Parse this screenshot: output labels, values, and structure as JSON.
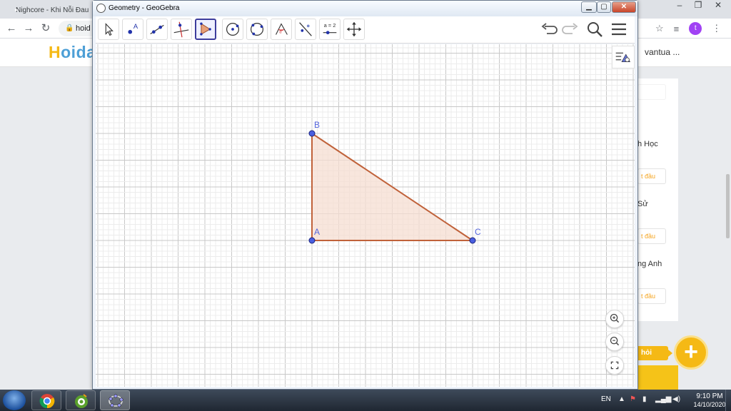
{
  "browser": {
    "tabs": [
      {
        "title": "Nighcore - Khi Nỗi Đau",
        "favicon": "youtube-icon"
      }
    ],
    "address": {
      "text": "hoid"
    },
    "profile_initial": "t",
    "controls": {
      "minimize": "–",
      "maximize": "❐",
      "close": "✕"
    }
  },
  "site": {
    "logo_prefix": "H",
    "logo_rest": "oidap",
    "user_name": "vantua ...",
    "subjects": [
      {
        "name": "h Học",
        "button": "t đầu"
      },
      {
        "name": "Sử",
        "button": "t đầu"
      },
      {
        "name": "ng Anh",
        "button": "t đầu"
      }
    ],
    "ask_label": "hỏi",
    "plus": "+"
  },
  "geogebra": {
    "window_title": "Geometry - GeoGebra",
    "window_controls": {
      "minimize": "▁",
      "maximize": "▢",
      "close": "✕"
    },
    "tools": [
      {
        "name": "move-tool-icon"
      },
      {
        "name": "point-tool-icon"
      },
      {
        "name": "segment-tool-icon"
      },
      {
        "name": "perpendicular-line-tool-icon"
      },
      {
        "name": "polygon-tool-icon"
      },
      {
        "name": "circle-center-point-tool-icon"
      },
      {
        "name": "circle-three-points-tool-icon"
      },
      {
        "name": "angle-tool-icon"
      },
      {
        "name": "reflect-tool-icon"
      },
      {
        "name": "slider-tool-icon",
        "label": "a = 2"
      },
      {
        "name": "move-view-tool-icon"
      }
    ],
    "active_tool": "polygon",
    "points": [
      {
        "label": "A"
      },
      {
        "label": "B"
      },
      {
        "label": "C"
      }
    ],
    "colors": {
      "polygon_stroke": "#c0623a",
      "polygon_fill": "#f6ddd2",
      "point_fill": "#4a5fe0",
      "point_label": "#5566dd",
      "active_tool_border": "#3d3d9c"
    }
  },
  "taskbar": {
    "language": "EN",
    "time": "9:10 PM",
    "date": "14/10/2020"
  }
}
